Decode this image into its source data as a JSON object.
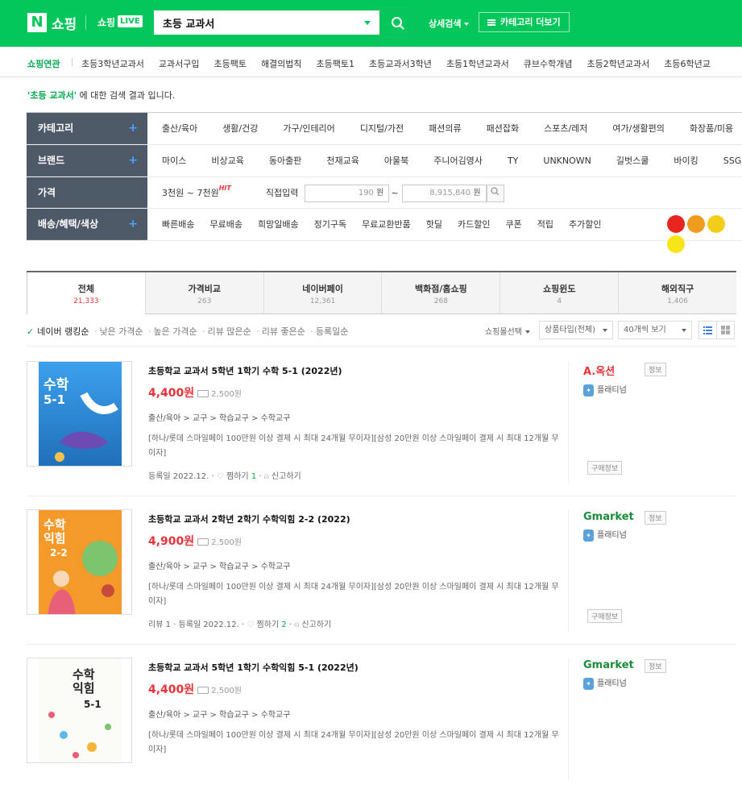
{
  "header": {
    "logo_n": "N",
    "logo_text": "쇼핑",
    "live_text": "쇼핑",
    "live_badge": "LIVE",
    "search_value": "초등 교과서",
    "advanced_search": "상세검색",
    "category_more": "카테고리 더보기"
  },
  "related": {
    "label": "쇼핑연관",
    "items": [
      "초등3학년교과서",
      "교과서구입",
      "초등팩토",
      "해결의법칙",
      "초등팩토1",
      "초등교과서3학년",
      "초등1학년교과서",
      "큐브수학개념",
      "초등2학년교과서",
      "초등6학년교"
    ]
  },
  "result_line": {
    "keyword": "'초등 교과서'",
    "suffix": " 에 대한 검색 결과 입니다."
  },
  "filters": {
    "category": {
      "label": "카테고리",
      "items": [
        "출산/육아",
        "생활/건강",
        "가구/인테리어",
        "디지털/가전",
        "패션의류",
        "패션잡화",
        "스포츠/레저",
        "여가/생활편의",
        "화장품/미용"
      ]
    },
    "brand": {
      "label": "브랜드",
      "items": [
        "마이스",
        "비상교육",
        "동아출판",
        "천재교육",
        "아울북",
        "주니어김영사",
        "TY",
        "UNKNOWN",
        "길벗스쿨",
        "바이킹",
        "SSG FO"
      ]
    },
    "price": {
      "label": "가격",
      "range_label": "3천원 ~ 7천원",
      "hit": "HIT",
      "direct_input": "직접입력",
      "min_value": "190",
      "max_value": "8,915,840",
      "unit": "원",
      "tilde": "~"
    },
    "delivery": {
      "label": "배송/혜택/색상",
      "items": [
        "빠른배송",
        "무료배송",
        "희망일배송",
        "정기구독",
        "무료교환반품",
        "핫딜",
        "카드할인",
        "쿠폰",
        "적립",
        "추가할인"
      ],
      "colors": [
        "#e8251f",
        "#f09a1e",
        "#f2cd1a",
        "#f7e51a"
      ]
    }
  },
  "tabs": [
    {
      "label": "전체",
      "count": "21,333"
    },
    {
      "label": "가격비교",
      "count": "263"
    },
    {
      "label": "네이버페이",
      "count": "12,361"
    },
    {
      "label": "백화점/홈쇼핑",
      "count": "268"
    },
    {
      "label": "쇼핑윈도",
      "count": "4"
    },
    {
      "label": "해외직구",
      "count": "1,406"
    }
  ],
  "sort": {
    "active": "네이버 랭킹순",
    "others": [
      "낮은 가격순",
      "높은 가격순",
      "리뷰 많은순",
      "리뷰 좋은순",
      "등록일순"
    ],
    "mall_select": "쇼핑몰선택",
    "product_type": "상품타입(전체)",
    "per_page": "40개씩 보기"
  },
  "products": [
    {
      "title": "초등학교 교과서 5학년 1학기 수학 5-1 (2022년)",
      "price": "4,400원",
      "shipping": "2,500원",
      "category": "출산/육아 > 교구 > 학습교구 > 수학교구",
      "desc": "[하나/롯데 스마일페이 100만원 이상 결제 시 최대 24개월 무이자][삼성 20만원 이상 스마일페이 결제 시 최대 12개월 무이자]",
      "review": "",
      "reg_date": "등록일 2022.12.",
      "zzim": "찜하기",
      "zzim_count": "1",
      "report": "신고하기",
      "seller": "A.옥션",
      "seller_info": "정보",
      "grade": "플래티넘",
      "buy_info": "구매정보",
      "thumb_title": "수학",
      "thumb_sub": "5-1"
    },
    {
      "title": "초등학교 교과서 2학년 2학기 수학익힘 2-2 (2022)",
      "price": "4,900원",
      "shipping": "2,500원",
      "category": "출산/육아 > 교구 > 학습교구 > 수학교구",
      "desc": "[하나/롯데 스마일페이 100만원 이상 결제 시 최대 24개월 무이자][삼성 20만원 이상 스마일페이 결제 시 최대 12개월 무이자]",
      "review": "리뷰 1",
      "reg_date": "등록일 2022.12.",
      "zzim": "찜하기",
      "zzim_count": "2",
      "report": "신고하기",
      "seller": "Gmarket",
      "seller_info": "정보",
      "grade": "플래티넘",
      "buy_info": "구매정보",
      "thumb_title": "수학 익힘",
      "thumb_sub": "2-2"
    },
    {
      "title": "초등학교 교과서 5학년 1학기 수학익힘 5-1 (2022년)",
      "price": "4,400원",
      "shipping": "2,500원",
      "category": "출산/육아 > 교구 > 학습교구 > 수학교구",
      "desc": "[하나/롯데 스마일페이 100만원 이상 결제 시 최대 24개월 무이자][삼성 20만원 이상 스마일페이 결제 시 최대 12개월 무이자]",
      "review": "",
      "reg_date": "",
      "zzim": "",
      "zzim_count": "",
      "report": "",
      "seller": "Gmarket",
      "seller_info": "정보",
      "grade": "플래티넘",
      "buy_info": "",
      "thumb_title": "수학 익힘",
      "thumb_sub": "5-1"
    }
  ]
}
